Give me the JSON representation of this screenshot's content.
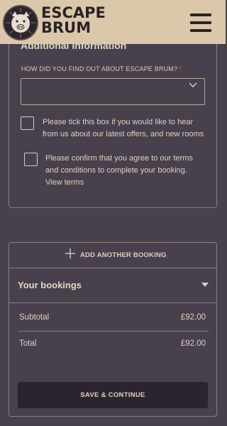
{
  "header": {
    "logo_line1": "ESCAPE",
    "logo_line2": "BRUM",
    "menu_icon": "hamburger-menu-icon"
  },
  "additional_info": {
    "heading": "Additional Information",
    "source_label": "HOW DID YOU FIND OUT ABOUT ESCAPE BRUM?",
    "required_marker": "*",
    "source_value": "",
    "marketing_checkbox": {
      "label": "Please tick this box if you would like to hear from us about our latest offers, and new rooms",
      "checked": false
    },
    "terms_checkbox": {
      "label": "Please confirm that you agree to our terms and conditions to complete your booking.",
      "link": "View terms",
      "checked": false
    }
  },
  "booking": {
    "add_label": "ADD ANOTHER BOOKING",
    "bookings_title": "Your bookings",
    "subtotal_label": "Subtotal",
    "subtotal_value": "£92.00",
    "total_label": "Total",
    "total_value": "£92.00",
    "save_label": "SAVE & CONTINUE"
  },
  "colors": {
    "background": "#48404d",
    "header": "#dbc8aa",
    "text": "#ddd2bf",
    "required": "#d7504c",
    "button": "#2b2430"
  }
}
